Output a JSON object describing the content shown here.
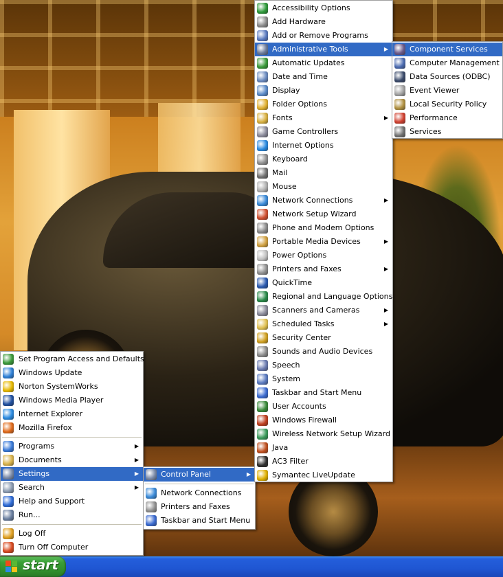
{
  "taskbar": {
    "start_label": "start"
  },
  "start_menu": {
    "pinned": [
      {
        "label": "Set Program Access and Defaults",
        "icon": "program-access-icon",
        "color": "#3a9a3a"
      },
      {
        "label": "Windows Update",
        "icon": "windows-update-icon",
        "color": "#2d7fd6"
      },
      {
        "label": "Norton SystemWorks",
        "icon": "norton-icon",
        "color": "#e6b800"
      },
      {
        "label": "Windows Media Player",
        "icon": "media-player-icon",
        "color": "#2050a0"
      },
      {
        "label": "Internet Explorer",
        "icon": "internet-explorer-icon",
        "color": "#2a8ae0"
      },
      {
        "label": "Mozilla Firefox",
        "icon": "firefox-icon",
        "color": "#e06a1a"
      }
    ],
    "main": [
      {
        "label": "Programs",
        "icon": "programs-icon",
        "color": "#3a7ad8",
        "arrow": true
      },
      {
        "label": "Documents",
        "icon": "documents-icon",
        "color": "#d9b34a",
        "arrow": true
      },
      {
        "label": "Settings",
        "icon": "settings-icon",
        "color": "#7a8aa8",
        "arrow": true,
        "highlight": true
      },
      {
        "label": "Search",
        "icon": "search-icon",
        "color": "#8a9ab0",
        "arrow": true
      },
      {
        "label": "Help and Support",
        "icon": "help-icon",
        "color": "#2d6ad6"
      },
      {
        "label": "Run...",
        "icon": "run-icon",
        "color": "#6a7fa0"
      }
    ],
    "bottom": [
      {
        "label": "Log Off",
        "icon": "log-off-icon",
        "color": "#e0a020"
      },
      {
        "label": "Turn Off Computer",
        "icon": "power-icon",
        "color": "#d84a20"
      }
    ]
  },
  "settings_menu": {
    "top": [
      {
        "label": "Control Panel",
        "icon": "control-panel-icon",
        "color": "#7a8aa8",
        "arrow": true,
        "highlight": true
      }
    ],
    "items": [
      {
        "label": "Network Connections",
        "icon": "network-connections-icon",
        "color": "#3a8ad8"
      },
      {
        "label": "Printers and Faxes",
        "icon": "printer-icon",
        "color": "#909090"
      },
      {
        "label": "Taskbar and Start Menu",
        "icon": "taskbar-icon",
        "color": "#3a6ad0"
      }
    ]
  },
  "control_panel_menu": {
    "items": [
      {
        "label": "Accessibility Options",
        "icon": "accessibility-icon",
        "color": "#2e9a3a"
      },
      {
        "label": "Add Hardware",
        "icon": "add-hardware-icon",
        "color": "#8a8a8a"
      },
      {
        "label": "Add or Remove Programs",
        "icon": "add-remove-programs-icon",
        "color": "#5a7ac0"
      },
      {
        "label": "Administrative Tools",
        "icon": "admin-tools-icon",
        "color": "#6a7a9a",
        "arrow": true,
        "highlight": true
      },
      {
        "label": "Automatic Updates",
        "icon": "automatic-updates-icon",
        "color": "#3a9a3a"
      },
      {
        "label": "Date and Time",
        "icon": "clock-icon",
        "color": "#6a8ac0"
      },
      {
        "label": "Display",
        "icon": "display-icon",
        "color": "#5a8ac8"
      },
      {
        "label": "Folder Options",
        "icon": "folder-options-icon",
        "color": "#e0b030"
      },
      {
        "label": "Fonts",
        "icon": "fonts-icon",
        "color": "#d8b040",
        "arrow": true
      },
      {
        "label": "Game Controllers",
        "icon": "game-controller-icon",
        "color": "#8a8a9a"
      },
      {
        "label": "Internet Options",
        "icon": "internet-options-icon",
        "color": "#2a8ae0"
      },
      {
        "label": "Keyboard",
        "icon": "keyboard-icon",
        "color": "#909090"
      },
      {
        "label": "Mail",
        "icon": "mail-icon",
        "color": "#707070"
      },
      {
        "label": "Mouse",
        "icon": "mouse-icon",
        "color": "#b0b0b0"
      },
      {
        "label": "Network Connections",
        "icon": "network-connections-icon",
        "color": "#3a8ad8",
        "arrow": true
      },
      {
        "label": "Network Setup Wizard",
        "icon": "network-wizard-icon",
        "color": "#d05030"
      },
      {
        "label": "Phone and Modem Options",
        "icon": "phone-icon",
        "color": "#8a8a8a"
      },
      {
        "label": "Portable Media Devices",
        "icon": "portable-media-icon",
        "color": "#d0a040",
        "arrow": true
      },
      {
        "label": "Power Options",
        "icon": "power-options-icon",
        "color": "#c0c0c0"
      },
      {
        "label": "Printers and Faxes",
        "icon": "printer-icon",
        "color": "#909090",
        "arrow": true
      },
      {
        "label": "QuickTime",
        "icon": "quicktime-icon",
        "color": "#2a5ab0"
      },
      {
        "label": "Regional and Language Options",
        "icon": "globe-icon",
        "color": "#2a8a4a"
      },
      {
        "label": "Scanners and Cameras",
        "icon": "scanner-icon",
        "color": "#8a8a9a",
        "arrow": true
      },
      {
        "label": "Scheduled Tasks",
        "icon": "scheduled-tasks-icon",
        "color": "#e0c050",
        "arrow": true
      },
      {
        "label": "Security Center",
        "icon": "security-center-icon",
        "color": "#d0a020"
      },
      {
        "label": "Sounds and Audio Devices",
        "icon": "sound-icon",
        "color": "#8a8a8a"
      },
      {
        "label": "Speech",
        "icon": "speech-icon",
        "color": "#6a7ab0"
      },
      {
        "label": "System",
        "icon": "system-icon",
        "color": "#5a7ac0"
      },
      {
        "label": "Taskbar and Start Menu",
        "icon": "taskbar-icon",
        "color": "#3a6ad0"
      },
      {
        "label": "User Accounts",
        "icon": "user-accounts-icon",
        "color": "#3a8a3a"
      },
      {
        "label": "Windows Firewall",
        "icon": "firewall-icon",
        "color": "#c04020"
      },
      {
        "label": "Wireless Network Setup Wizard",
        "icon": "wireless-icon",
        "color": "#3a9a5a"
      },
      {
        "label": "Java",
        "icon": "java-icon",
        "color": "#c05020"
      },
      {
        "label": "AC3 Filter",
        "icon": "ac3-filter-icon",
        "color": "#303030"
      },
      {
        "label": "Symantec LiveUpdate",
        "icon": "liveupdate-icon",
        "color": "#e0b000"
      }
    ]
  },
  "admin_tools_menu": {
    "items": [
      {
        "label": "Component Services",
        "icon": "component-services-icon",
        "color": "#6a5a8a",
        "highlight": true
      },
      {
        "label": "Computer Management",
        "icon": "computer-management-icon",
        "color": "#4a6ab0"
      },
      {
        "label": "Data Sources (ODBC)",
        "icon": "odbc-icon",
        "color": "#3a4a6a"
      },
      {
        "label": "Event Viewer",
        "icon": "event-viewer-icon",
        "color": "#a0a0a0"
      },
      {
        "label": "Local Security Policy",
        "icon": "security-policy-icon",
        "color": "#b09040"
      },
      {
        "label": "Performance",
        "icon": "performance-icon",
        "color": "#d04030"
      },
      {
        "label": "Services",
        "icon": "services-icon",
        "color": "#707070"
      }
    ]
  }
}
